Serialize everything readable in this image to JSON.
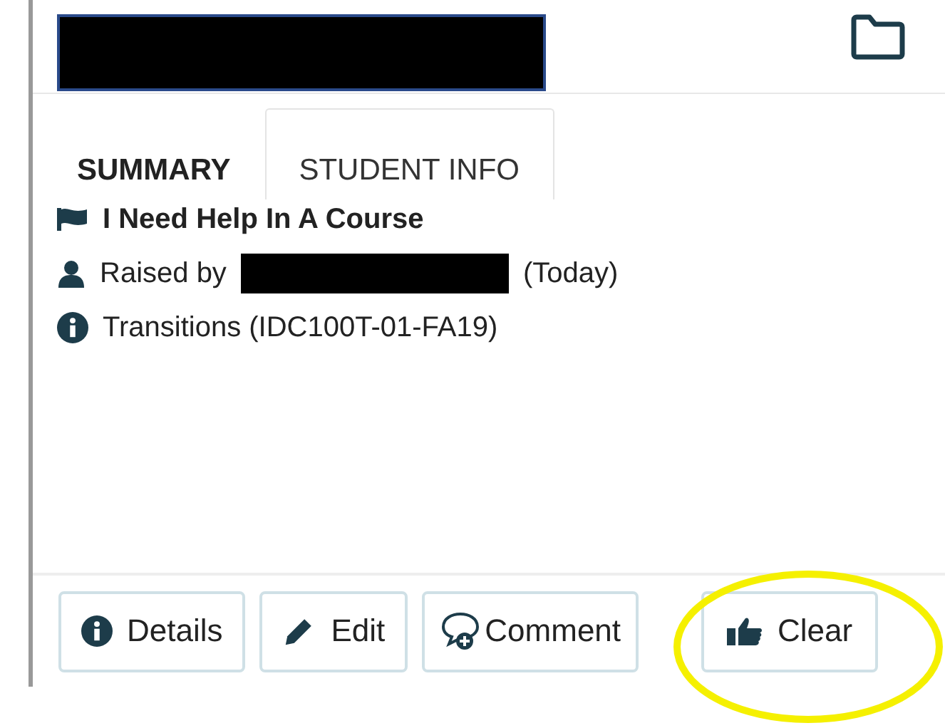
{
  "tabs": [
    {
      "label": "SUMMARY",
      "selected": true
    },
    {
      "label": "STUDENT INFO",
      "selected": false
    }
  ],
  "summary": {
    "title": "I Need Help In A Course",
    "raised_label": "Raised by",
    "raised_when": "(Today)",
    "course": "Transitions (IDC100T-01-FA19)"
  },
  "buttons": [
    {
      "kind": "info",
      "label": "Details"
    },
    {
      "kind": "edit",
      "label": "Edit"
    },
    {
      "kind": "comment",
      "label": "Comment"
    },
    {
      "kind": "clear",
      "label": "Clear"
    }
  ]
}
